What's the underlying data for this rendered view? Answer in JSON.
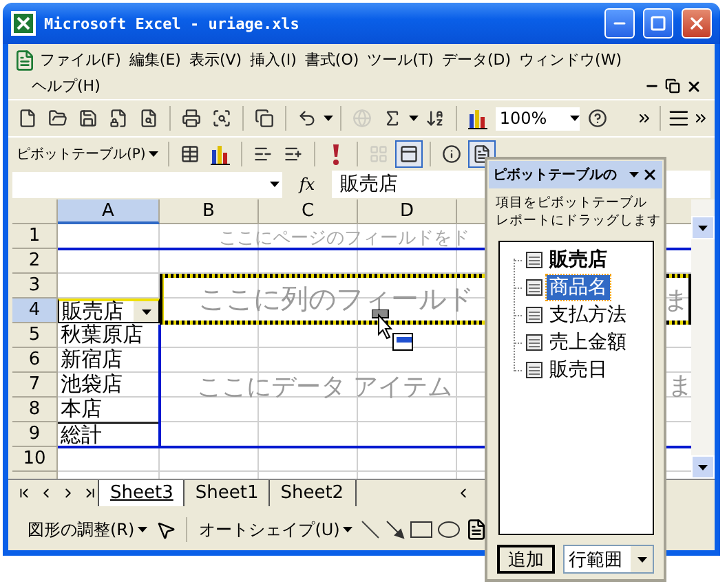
{
  "window": {
    "title": "Microsoft Excel - uriage.xls"
  },
  "menu": [
    "ファイル(F)",
    "編集(E)",
    "表示(V)",
    "挿入(I)",
    "書式(O)",
    "ツール(T)",
    "データ(D)",
    "ウィンドウ(W)",
    "ヘルプ(H)"
  ],
  "standard_toolbar": {
    "zoom": "100%",
    "buttons": [
      {
        "disabled": false
      },
      {
        "disabled": false
      },
      {
        "disabled": false
      },
      {
        "disabled": false
      },
      {
        "disabled": false
      },
      {
        "disabled": false
      },
      {
        "disabled": false
      },
      {
        "disabled": false
      },
      {
        "disabled": false
      },
      {
        "disabled": true
      },
      {
        "disabled": false
      },
      {
        "disabled": false
      },
      {
        "disabled": false
      }
    ]
  },
  "pivot_toolbar": {
    "label": "ピボットテーブル(P)",
    "buttons": [
      {
        "pressed": false,
        "disabled": false
      },
      {
        "pressed": false,
        "disabled": false
      },
      {
        "pressed": false,
        "disabled": false
      },
      {
        "pressed": false,
        "disabled": false
      },
      {
        "pressed": false,
        "disabled": false
      },
      {
        "pressed": false,
        "disabled": true
      },
      {
        "pressed": true,
        "disabled": false
      },
      {
        "pressed": false,
        "disabled": false
      },
      {
        "pressed": true,
        "disabled": false
      }
    ]
  },
  "formula_bar": {
    "fx": "fx",
    "value": "販売店"
  },
  "columns": [
    {
      "label": "A",
      "selected": true
    },
    {
      "label": "B",
      "selected": false
    },
    {
      "label": "C",
      "selected": false
    },
    {
      "label": "D",
      "selected": false
    }
  ],
  "rows": [
    {
      "number": "1",
      "selected": false,
      "kind": "blank"
    },
    {
      "number": "2",
      "selected": false,
      "kind": "blank"
    },
    {
      "number": "3",
      "selected": false,
      "kind": "blank"
    },
    {
      "number": "4",
      "selected": true,
      "kind": "field",
      "a": "販売店"
    },
    {
      "number": "5",
      "selected": false,
      "kind": "item",
      "a": "秋葉原店"
    },
    {
      "number": "6",
      "selected": false,
      "kind": "item",
      "a": "新宿店"
    },
    {
      "number": "7",
      "selected": false,
      "kind": "item",
      "a": "池袋店"
    },
    {
      "number": "8",
      "selected": false,
      "kind": "item",
      "a": "本店"
    },
    {
      "number": "9",
      "selected": false,
      "kind": "total",
      "a": "総計"
    },
    {
      "number": "10",
      "selected": false,
      "kind": "blank"
    }
  ],
  "pivot_area": {
    "page_hint": "ここにページのフィールドをド",
    "column_hint": "ここに列のフィールド",
    "column_hint_tail": "ま",
    "data_hint": "ここにデータ アイテム",
    "data_hint_tail": "ま"
  },
  "sheet_tabs": [
    {
      "label": "Sheet3",
      "selected": true
    },
    {
      "label": "Sheet1",
      "selected": false
    },
    {
      "label": "Sheet2",
      "selected": false
    }
  ],
  "drawing_toolbar": {
    "arrange": "図形の調整(R)",
    "autoshape": "オートシェイプ(U)"
  },
  "field_list": {
    "title": "ピボットテーブルの",
    "description": [
      "項目をピボットテーブル",
      "レポートにドラッグします"
    ],
    "add_button": "追加",
    "area": "行範囲",
    "fields": [
      {
        "label": "販売店",
        "used": true,
        "selected": false
      },
      {
        "label": "商品名",
        "used": false,
        "selected": true
      },
      {
        "label": "支払方法",
        "used": false,
        "selected": false
      },
      {
        "label": "売上金額",
        "used": false,
        "selected": false
      },
      {
        "label": "販売日",
        "used": false,
        "selected": false
      }
    ]
  }
}
